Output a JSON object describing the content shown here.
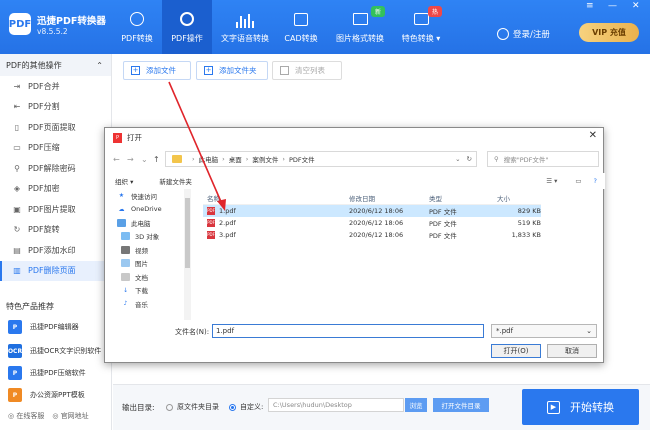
{
  "app": {
    "name": "迅捷PDF转换器",
    "version": "v8.5.5.2",
    "logo_text": "PDF"
  },
  "nav": [
    {
      "label": "PDF转换",
      "icon": "refresh-icon"
    },
    {
      "label": "PDF操作",
      "icon": "gear-icon"
    },
    {
      "label": "文字语音转换",
      "icon": "audio-bars-icon"
    },
    {
      "label": "CAD转换",
      "icon": "cad-icon"
    },
    {
      "label": "图片格式转换",
      "icon": "image-icon",
      "badge": "新"
    },
    {
      "label": "特色转换",
      "icon": "camera-icon",
      "badge": "热",
      "arrow": "▾"
    }
  ],
  "login": "登录/注册",
  "vip": "VIP 充值",
  "window": {
    "menu": "≡",
    "minimize": "—",
    "close": "✕"
  },
  "sidebar": {
    "header": "PDF的其他操作",
    "items": [
      "PDF合并",
      "PDF分割",
      "PDF页面提取",
      "PDF压缩",
      "PDF解除密码",
      "PDF加密",
      "PDF图片提取",
      "PDF旋转",
      "PDF添加水印",
      "PDF删除页面"
    ],
    "feature_title": "特色产品推荐",
    "features": [
      "迅捷PDF编辑器",
      "迅捷OCR文字识别软件",
      "迅捷PDF压缩软件",
      "办公资源PPT模板"
    ],
    "footer": [
      "在线客服",
      "官网地址"
    ]
  },
  "toolbar": {
    "add_file": "添加文件",
    "add_folder": "添加文件夹",
    "clear": "清空列表"
  },
  "dialog": {
    "title": "打开",
    "breadcrumb": [
      "此电脑",
      "桌面",
      "案例文件",
      "PDF文件"
    ],
    "search_placeholder": "搜索\"PDF文件\"",
    "organize": "组织 ▾",
    "new_folder": "新建文件夹",
    "tree": [
      "快速访问",
      "OneDrive",
      "此电脑",
      "3D 对象",
      "视频",
      "图片",
      "文档",
      "下载",
      "音乐"
    ],
    "columns": {
      "name": "名称",
      "date": "修改日期",
      "type": "类型",
      "size": "大小"
    },
    "files": [
      {
        "name": "1.pdf",
        "date": "2020/6/12 18:06",
        "type": "PDF 文件",
        "size": "829 KB"
      },
      {
        "name": "2.pdf",
        "date": "2020/6/12 18:06",
        "type": "PDF 文件",
        "size": "519 KB"
      },
      {
        "name": "3.pdf",
        "date": "2020/6/12 18:06",
        "type": "PDF 文件",
        "size": "1,833 KB"
      }
    ],
    "filename_label": "文件名(N):",
    "filename_value": "1.pdf",
    "filetype_value": "*.pdf",
    "open": "打开(O)",
    "cancel": "取消"
  },
  "output": {
    "label": "输出目录:",
    "option1": "原文件夹目录",
    "option2": "自定义:",
    "path_placeholder": "C:\\Users\\hudun\\Desktop",
    "browse": "浏览",
    "open_dir": "打开文件目录"
  },
  "start": "开始转换",
  "colors": {
    "accent": "#2a78ee",
    "header": "#2c7cf0",
    "arrow": "#e0252b"
  }
}
